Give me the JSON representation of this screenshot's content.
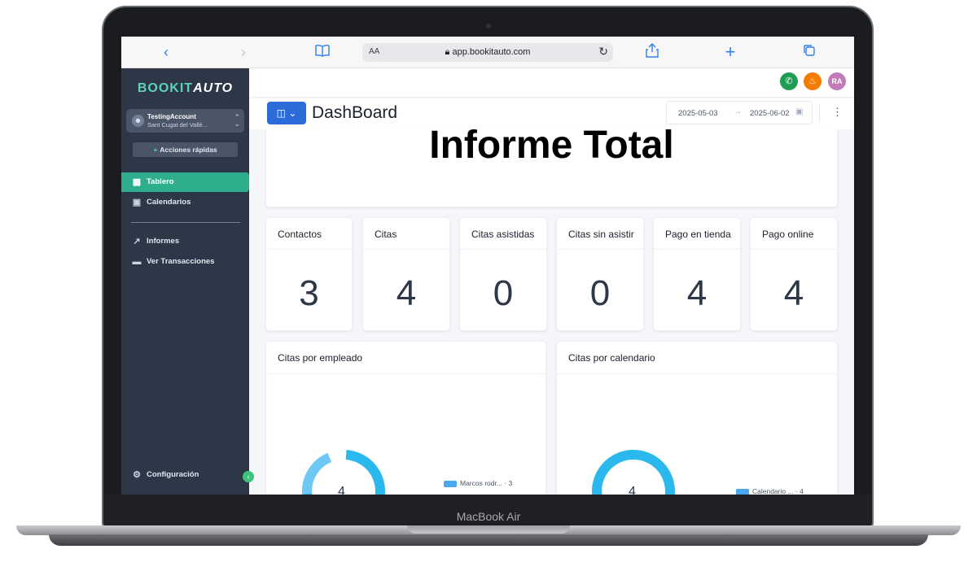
{
  "device": {
    "label": "MacBook Air"
  },
  "browser": {
    "url_prefix": "AA",
    "url": "app.bookitauto.com",
    "icons": [
      "back-icon",
      "forward-icon",
      "bookmarks-icon",
      "lock-icon",
      "reload-icon",
      "share-icon",
      "new-tab-icon",
      "tabs-icon"
    ]
  },
  "sidebar": {
    "logo_part1": "BOOKIT",
    "logo_part2": "AUTO",
    "account": {
      "name": "TestingAccount",
      "location": "Sant Cugat del Vallè..."
    },
    "quick_actions": "Acciones rápidas",
    "items": [
      {
        "label": "Tablero",
        "icon": "dashboard-grid-icon",
        "active": true
      },
      {
        "label": "Calendarios",
        "icon": "calendar-icon",
        "active": false
      },
      {
        "label": "Informes",
        "icon": "trend-chart-icon",
        "active": false
      },
      {
        "label": "Ver Transacciones",
        "icon": "card-icon",
        "active": false
      }
    ],
    "settings": {
      "label": "Configuración",
      "icon": "gear-icon"
    }
  },
  "header": {
    "avatar_initials": "RA",
    "colors": {
      "phone": "#1f9d55",
      "bell": "#f57c00",
      "avatar": "#c27ab8"
    }
  },
  "dashboard": {
    "title": "DashBoard",
    "date_start": "2025-05-03",
    "date_end": "2025-06-02"
  },
  "report": {
    "title": "Informe Total"
  },
  "stats": [
    {
      "label": "Contactos",
      "value": "3"
    },
    {
      "label": "Citas",
      "value": "4"
    },
    {
      "label": "Citas asistidas",
      "value": "0"
    },
    {
      "label": "Citas sin asistir",
      "value": "0"
    },
    {
      "label": "Pago en tienda",
      "value": "4"
    },
    {
      "label": "Pago online",
      "value": "4"
    }
  ],
  "charts": [
    {
      "title": "Citas por empleado",
      "center": "4",
      "legend": "Marcos rodr... · 3"
    },
    {
      "title": "Citas por calendario",
      "center": "4",
      "legend": "Calendario ... · 4"
    }
  ],
  "colors": {
    "sidebar": "#2d3748",
    "active": "#2fae8e",
    "primary": "#2b6cd9",
    "donut": "#2bb8ec"
  }
}
